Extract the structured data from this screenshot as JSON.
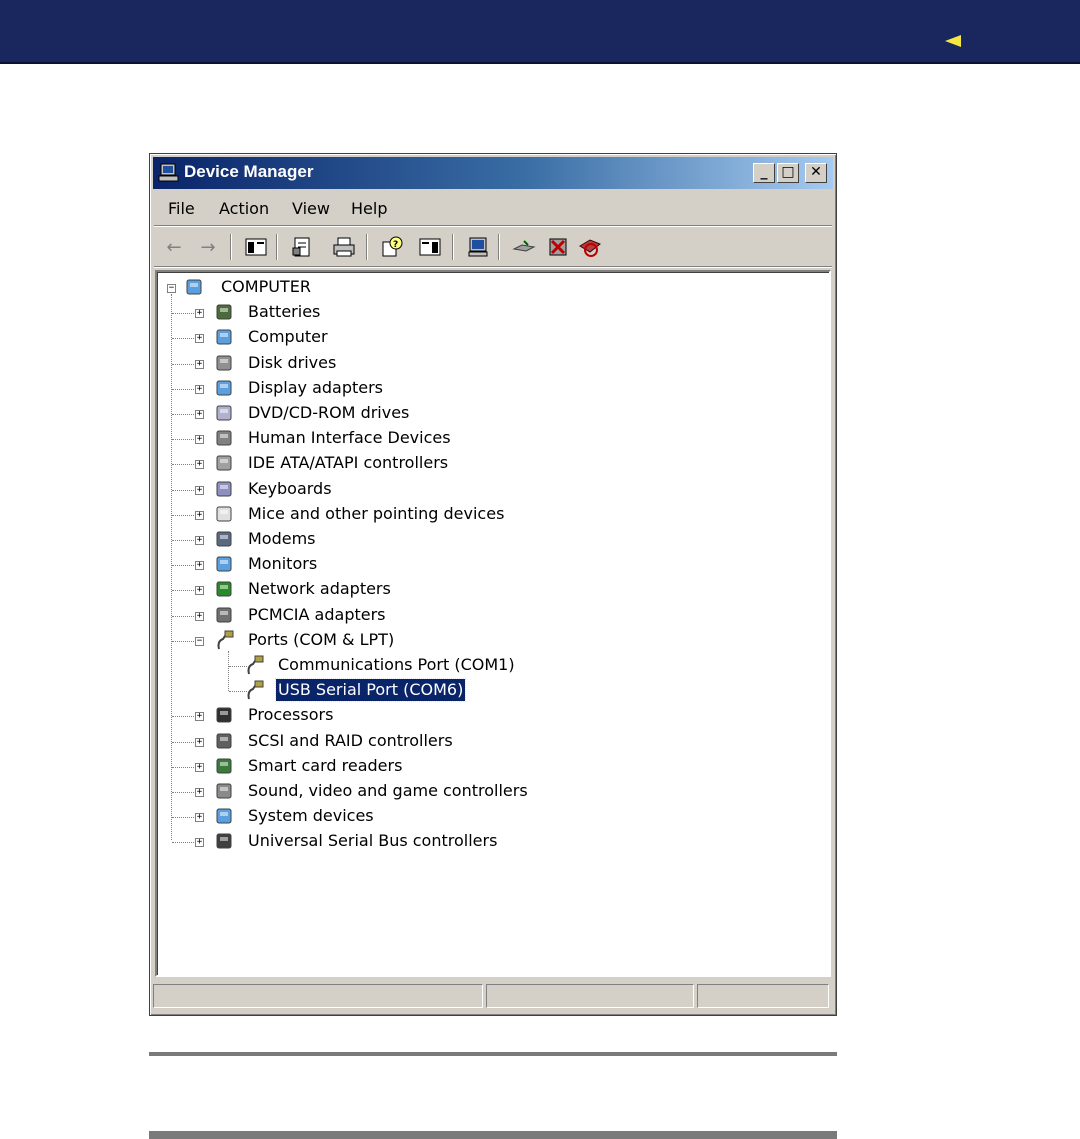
{
  "window": {
    "title": "Device Manager",
    "controls": {
      "minimize": "_",
      "maximize": "□",
      "close": "✕"
    }
  },
  "menu": [
    {
      "label": "File"
    },
    {
      "label": "Action"
    },
    {
      "label": "View"
    },
    {
      "label": "Help"
    }
  ],
  "toolbar": [
    "back-arrow-icon",
    "forward-arrow-icon",
    "show-hide-console-tree-icon",
    "properties-icon",
    "print-icon",
    "help-icon",
    "action-pane-icon",
    "scan-hardware-icon",
    "update-driver-icon",
    "uninstall-icon",
    "disable-icon"
  ],
  "tree": {
    "root": "COMPUTER",
    "categories": [
      {
        "label": "Batteries",
        "icon": "battery-icon"
      },
      {
        "label": "Computer",
        "icon": "computer-icon"
      },
      {
        "label": "Disk drives",
        "icon": "disk-drive-icon"
      },
      {
        "label": "Display adapters",
        "icon": "display-adapter-icon"
      },
      {
        "label": "DVD/CD-ROM drives",
        "icon": "cdrom-icon"
      },
      {
        "label": "Human Interface Devices",
        "icon": "hid-icon"
      },
      {
        "label": "IDE ATA/ATAPI controllers",
        "icon": "ide-controller-icon"
      },
      {
        "label": "Keyboards",
        "icon": "keyboard-icon"
      },
      {
        "label": "Mice and other pointing devices",
        "icon": "mouse-icon"
      },
      {
        "label": "Modems",
        "icon": "modem-icon"
      },
      {
        "label": "Monitors",
        "icon": "monitor-icon"
      },
      {
        "label": "Network adapters",
        "icon": "network-adapter-icon"
      },
      {
        "label": "PCMCIA adapters",
        "icon": "pcmcia-icon"
      },
      {
        "label": "Ports (COM & LPT)",
        "icon": "port-icon",
        "expanded": true,
        "children": [
          {
            "label": "Communications Port (COM1)",
            "icon": "port-icon"
          },
          {
            "label": "USB Serial Port (COM6)",
            "icon": "port-icon",
            "selected": true
          }
        ]
      },
      {
        "label": "Processors",
        "icon": "processor-icon"
      },
      {
        "label": "SCSI and RAID controllers",
        "icon": "scsi-icon"
      },
      {
        "label": "Smart card readers",
        "icon": "smart-card-icon"
      },
      {
        "label": "Sound, video and game controllers",
        "icon": "sound-icon"
      },
      {
        "label": "System devices",
        "icon": "system-device-icon"
      },
      {
        "label": "Universal Serial Bus controllers",
        "icon": "usb-icon"
      }
    ]
  },
  "statusbar": [
    "",
    "",
    ""
  ]
}
